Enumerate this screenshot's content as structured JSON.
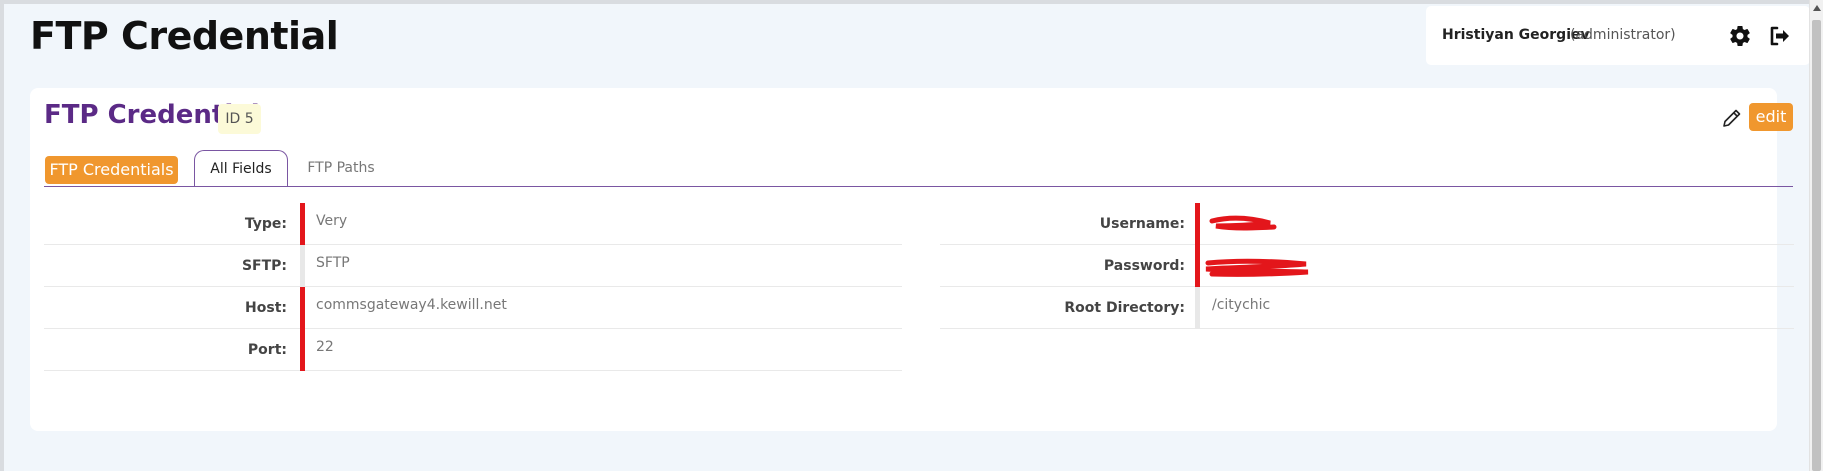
{
  "header": {
    "page_title": "FTP Credential",
    "user_name": "Hristiyan Georgiev",
    "user_role": "(administrator)",
    "icons": {
      "settings": "gear-icon",
      "logout": "sign-out-icon"
    }
  },
  "record": {
    "title": "FTP Credential",
    "id_badge": "ID 5",
    "edit_label": "edit",
    "edit_icon": "pencil-icon"
  },
  "tabs": {
    "section_label": "FTP Credentials",
    "items": [
      {
        "label": "All Fields",
        "active": true
      },
      {
        "label": "FTP Paths",
        "active": false
      }
    ]
  },
  "fields": {
    "left": [
      {
        "label": "Type:",
        "value": "Very",
        "required": true
      },
      {
        "label": "SFTP:",
        "value": "SFTP",
        "required": false
      },
      {
        "label": "Host:",
        "value": "commsgateway4.kewill.net",
        "required": true
      },
      {
        "label": "Port:",
        "value": "22",
        "required": true
      }
    ],
    "right": [
      {
        "label": "Username:",
        "value": "",
        "required": true,
        "redacted": true
      },
      {
        "label": "Password:",
        "value": "",
        "required": true,
        "redacted": true
      },
      {
        "label": "Root Directory:",
        "value": "/citychic",
        "required": false
      }
    ]
  },
  "colors": {
    "accent_orange": "#f0972e",
    "title_purple": "#5b2a86",
    "required_red": "#e3161b",
    "id_badge_bg": "#fcfad8",
    "page_bg": "#f1f6fb"
  }
}
